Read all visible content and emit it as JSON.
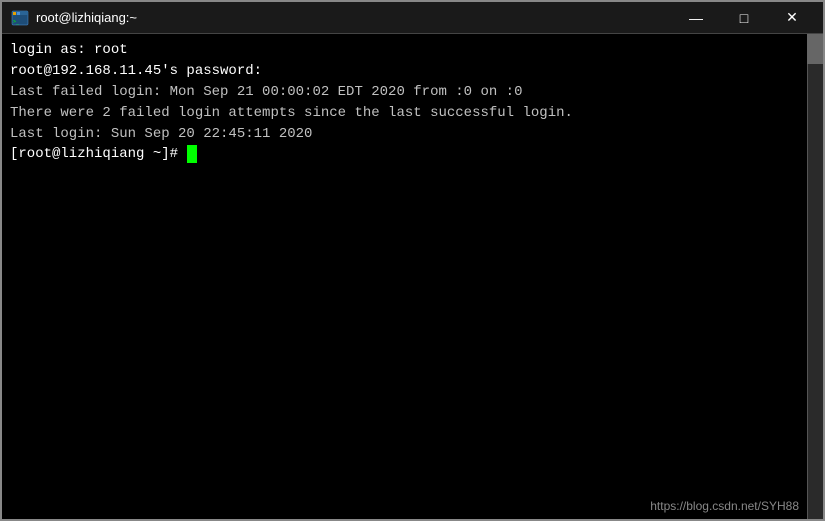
{
  "window": {
    "title": "root@lizhiqiang:~",
    "titlebar_icon": "terminal-icon"
  },
  "controls": {
    "minimize": "—",
    "maximize": "□",
    "close": "✕"
  },
  "terminal": {
    "lines": [
      {
        "text": "login as: root",
        "color": "white"
      },
      {
        "text": "root@192.168.11.45's password:",
        "color": "white"
      },
      {
        "text": "Last failed login: Mon Sep 21 00:00:02 EDT 2020 from :0 on :0",
        "color": "normal"
      },
      {
        "text": "There were 2 failed login attempts since the last successful login.",
        "color": "normal"
      },
      {
        "text": "Last login: Sun Sep 20 22:45:11 2020",
        "color": "normal"
      }
    ],
    "prompt": "[root@lizhiqiang ~]# "
  },
  "watermark": {
    "text": "https://blog.csdn.net/SYH88"
  }
}
